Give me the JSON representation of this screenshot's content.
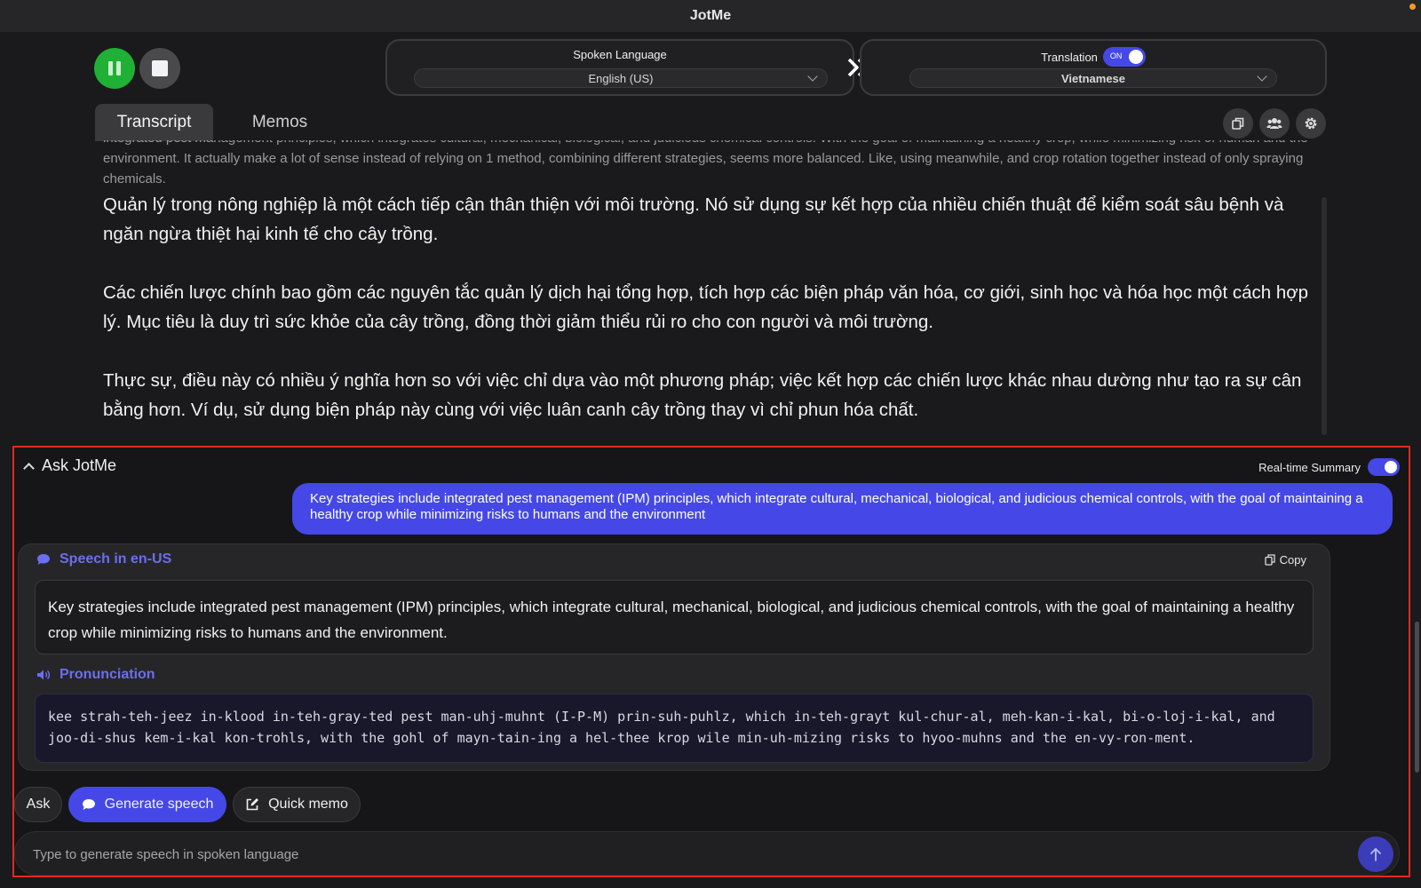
{
  "window": {
    "title": "JotMe"
  },
  "controls": {
    "pause_icon": "pause-icon",
    "stop_icon": "stop-icon"
  },
  "spoken": {
    "label": "Spoken Language",
    "value": "English (US)"
  },
  "translation": {
    "label": "Translation",
    "toggle_text": "ON",
    "value": "Vietnamese"
  },
  "tabs": [
    {
      "label": "Transcript",
      "active": true
    },
    {
      "label": "Memos",
      "active": false
    }
  ],
  "toolbar_icons": [
    "copy-icon",
    "people-icon",
    "gear-icon"
  ],
  "transcript": {
    "original": "integrated pest management principles, which integrates cultural, mechanical, biological, and judicious chemical controls. With the goal of maintaining a healthy crop, while minimizing risk of human and the environment. It actually make a lot of sense instead of relying on 1 method, combining different strategies, seems more balanced. Like, using meanwhile, and crop rotation together instead of only spraying chemicals.",
    "translated": [
      "Quản lý trong nông nghiệp là một cách tiếp cận thân thiện với môi trường. Nó sử dụng sự kết hợp của nhiều chiến thuật để kiểm soát sâu bệnh và ngăn ngừa thiệt hại kinh tế cho cây trồng.",
      "Các chiến lược chính bao gồm các nguyên tắc quản lý dịch hại tổng hợp, tích hợp các biện pháp văn hóa, cơ giới, sinh học và hóa học một cách hợp lý. Mục tiêu là duy trì sức khỏe của cây trồng, đồng thời giảm thiểu rủi ro cho con người và môi trường.",
      "Thực sự, điều này có nhiều ý nghĩa hơn so với việc chỉ dựa vào một phương pháp; việc kết hợp các chiến lược khác nhau dường như tạo ra sự cân bằng hơn. Ví dụ, sử dụng biện pháp này cùng với việc luân canh cây trồng thay vì chỉ phun hóa chất."
    ]
  },
  "ask": {
    "title": "Ask JotMe",
    "realtime_label": "Real-time Summary",
    "user_message": "Key strategies include integrated pest management (IPM) principles, which integrate cultural, mechanical, biological, and judicious chemical controls, with the goal of maintaining a healthy crop while minimizing risks to humans and the environment",
    "speech_label": "Speech in en-US",
    "copy_label": "Copy",
    "speech_text": "Key strategies include integrated pest management (IPM) principles, which integrate cultural, mechanical, biological, and judicious chemical controls, with the goal of maintaining a healthy crop while minimizing risks to humans and the environment.",
    "pronunciation_label": "Pronunciation",
    "pronunciation_text": "kee strah-teh-jeez in-klood in-teh-gray-ted pest man-uhj-muhnt (I-P-M) prin-suh-puhlz, which in-teh-grayt kul-chur-al, meh-kan-i-kal, bi-o-loj-i-kal, and joo-di-shus kem-i-kal kon-trohls, with the gohl of mayn-tain-ing a hel-thee krop wile min-uh-mizing risks to hyoo-muhns and the en-vy-ron-ment.",
    "chips": {
      "ask": "Ask",
      "generate": "Generate speech",
      "memo": "Quick memo"
    },
    "input_placeholder": "Type to generate speech in spoken language"
  },
  "colors": {
    "accent": "#4548e6",
    "record_green": "#1fb035",
    "highlight_border": "#e0291f"
  }
}
